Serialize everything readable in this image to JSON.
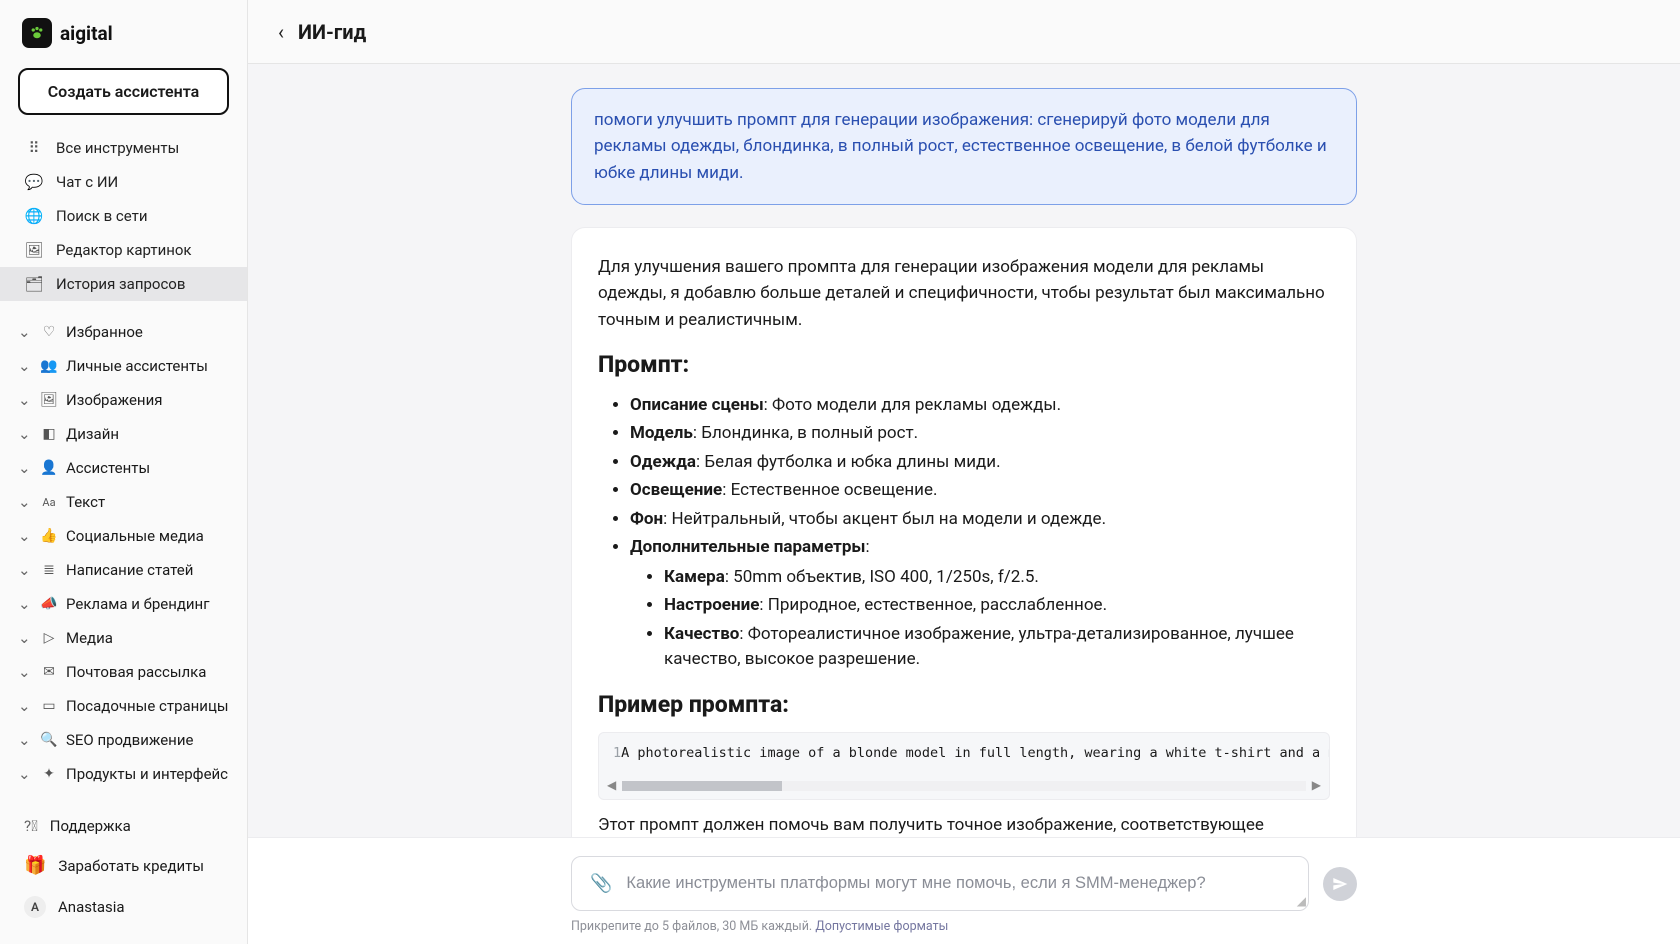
{
  "brand": {
    "name": "aigital"
  },
  "sidebar": {
    "create_button": "Создать ассистента",
    "nav": [
      {
        "label": "Все инструменты",
        "icon": "grid"
      },
      {
        "label": "Чат с ИИ",
        "icon": "chat"
      },
      {
        "label": "Поиск в сети",
        "icon": "globe"
      },
      {
        "label": "Редактор картинок",
        "icon": "image-edit"
      },
      {
        "label": "История запросов",
        "icon": "archive",
        "active": true
      }
    ],
    "groups": [
      {
        "label": "Избранное",
        "icon": "heart"
      },
      {
        "label": "Личные ассистенты",
        "icon": "people"
      },
      {
        "label": "Изображения",
        "icon": "image"
      },
      {
        "label": "Дизайн",
        "icon": "design"
      },
      {
        "label": "Ассистенты",
        "icon": "assistants"
      },
      {
        "label": "Текст",
        "icon": "Aa"
      },
      {
        "label": "Социальные медиа",
        "icon": "thumb"
      },
      {
        "label": "Написание статей",
        "icon": "lines"
      },
      {
        "label": "Реклама и брендинг",
        "icon": "megaphone"
      },
      {
        "label": "Медиа",
        "icon": "media"
      },
      {
        "label": "Почтовая рассылка",
        "icon": "mail"
      },
      {
        "label": "Посадочные страницы",
        "icon": "page"
      },
      {
        "label": "SEO продвижение",
        "icon": "seo"
      },
      {
        "label": "Продукты и интерфейс",
        "icon": "sparkle"
      }
    ],
    "bottom": {
      "support": "Поддержка",
      "earn": "Заработать кредиты",
      "user_initial": "A",
      "user_name": "Anastasia"
    }
  },
  "header": {
    "title": "ИИ-гид"
  },
  "chat": {
    "user_message": "помоги улучшить промпт для генерации изображения: сгенерируй фото модели для рекламы одежды, блондинка, в полный рост, естественное освещение, в белой футболке и юбке длины миди.",
    "assistant": {
      "intro": "Для улучшения вашего промпта для генерации изображения модели для рекламы одежды, я добавлю больше деталей и специфичности, чтобы результат был максимально точным и реалистичным.",
      "prompt_heading": "Промпт:",
      "items": [
        {
          "k": "Описание сцены",
          "v": "Фото модели для рекламы одежды."
        },
        {
          "k": "Модель",
          "v": "Блондинка, в полный рост."
        },
        {
          "k": "Одежда",
          "v": "Белая футболка и юбка длины миди."
        },
        {
          "k": "Освещение",
          "v": "Естественное освещение."
        },
        {
          "k": "Фон",
          "v": "Нейтральный, чтобы акцент был на модели и одежде."
        },
        {
          "k": "Дополнительные параметры",
          "v": ""
        }
      ],
      "subitems": [
        {
          "k": "Камера",
          "v": "50mm объектив, ISO 400, 1/250s, f/2.5."
        },
        {
          "k": "Настроение",
          "v": "Природное, естественное, расслабленное."
        },
        {
          "k": "Качество",
          "v": "Фотореалистичное изображение, ультра-детализированное, лучшее качество, высокое разрешение."
        }
      ],
      "example_heading": "Пример промпта:",
      "code": {
        "n": "1",
        "text": "A photorealistic image of a blonde model in full length, wearing a white t-shirt and a mid"
      },
      "outro": "Этот промпт должен помочь вам получить точное изображение, соответствующее вашему запросу. Если у вас есть дополнительные пожелания или детали, которые нужно"
    }
  },
  "composer": {
    "placeholder": "Какие инструменты платформы могут мне помочь, если я SMM-менеджер?",
    "hint_prefix": "Прикрепите до 5 файлов, 30 МБ каждый. ",
    "hint_link": "Допустимые форматы"
  }
}
